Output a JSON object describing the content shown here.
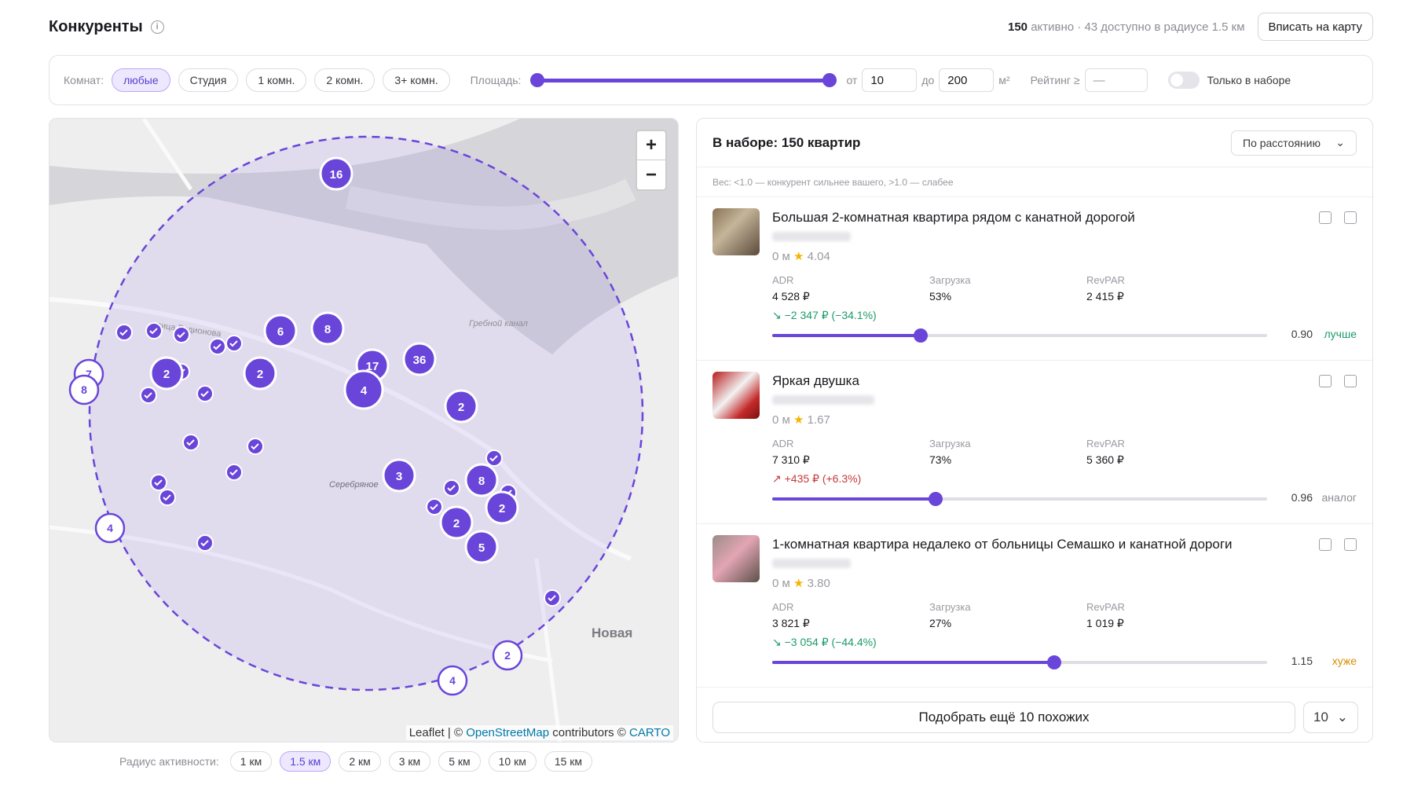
{
  "header": {
    "title": "Конкуренты",
    "stats_count": "150",
    "stats_rest": "активно · 43 доступно в радиусе 1.5 км",
    "fit_button": "Вписать на карту"
  },
  "filters": {
    "rooms_label": "Комнат:",
    "rooms": [
      "любые",
      "Студия",
      "1 комн.",
      "2 комн.",
      "3+ комн."
    ],
    "area_label": "Площадь:",
    "from_label": "от",
    "from_value": "10",
    "to_label": "до",
    "to_value": "200",
    "unit": "м²",
    "rating_label": "Рейтинг ≥",
    "rating_placeholder": "—",
    "only_set_label": "Только в наборе"
  },
  "map": {
    "zoom_in": "+",
    "zoom_out": "−",
    "place_label_canal": "Гребной канал",
    "place_label_district": "Серебряное",
    "place_label_new": "Новая",
    "street_label": "улица Родионова",
    "attribution_prefix": "Leaflet | ©",
    "attribution_osm": "OpenStreetMap",
    "attribution_mid": "contributors ©",
    "attribution_carto": "CARTO",
    "accent_color": "#6a45d9",
    "clusters": [
      "16",
      "6",
      "8",
      "17",
      "36",
      "4",
      "2",
      "2",
      "2",
      "3",
      "8",
      "2",
      "2",
      "5",
      "7",
      "8",
      "4",
      "4",
      "2"
    ]
  },
  "radius": {
    "label": "Радиус активности:",
    "options": [
      "1 км",
      "1.5 км",
      "2 км",
      "3 км",
      "5 км",
      "10 км",
      "15 км"
    ],
    "selected": "1.5 км"
  },
  "panel": {
    "title": "В наборе: 150 квартир",
    "sort_value": "По расстоянию",
    "hint": "Вес: <1.0 — конкурент сильнее вашего, >1.0 — слабее",
    "metric_labels": [
      "ADR",
      "Загрузка",
      "RevPAR"
    ],
    "items": [
      {
        "title": "Большая 2-комнатная квартира рядом с канатной дорогой",
        "distance": "0 м",
        "rating": "4.04",
        "adr": "4 528 ₽",
        "load": "53%",
        "revpar": "2 415 ₽",
        "delta": "↘ −2 347 ₽ (−34.1%)",
        "weight": "0.90",
        "weight_label": "лучше",
        "weight_fraction": 0.3
      },
      {
        "title": "Яркая двушка",
        "distance": "0 м",
        "rating": "1.67",
        "adr": "7 310 ₽",
        "load": "73%",
        "revpar": "5 360 ₽",
        "delta": "↗ +435 ₽ (+6.3%)",
        "weight": "0.96",
        "weight_label": "аналог",
        "weight_fraction": 0.33
      },
      {
        "title": "1-комнатная квартира недалеко от больницы Семашко и канатной дороги",
        "distance": "0 м",
        "rating": "3.80",
        "adr": "3 821 ₽",
        "load": "27%",
        "revpar": "1 019 ₽",
        "delta": "↘ −3 054 ₽ (−44.4%)",
        "weight": "1.15",
        "weight_label": "хуже",
        "weight_fraction": 0.57
      }
    ],
    "more_button": "Подобрать ещё 10 похожих",
    "count_value": "10"
  }
}
